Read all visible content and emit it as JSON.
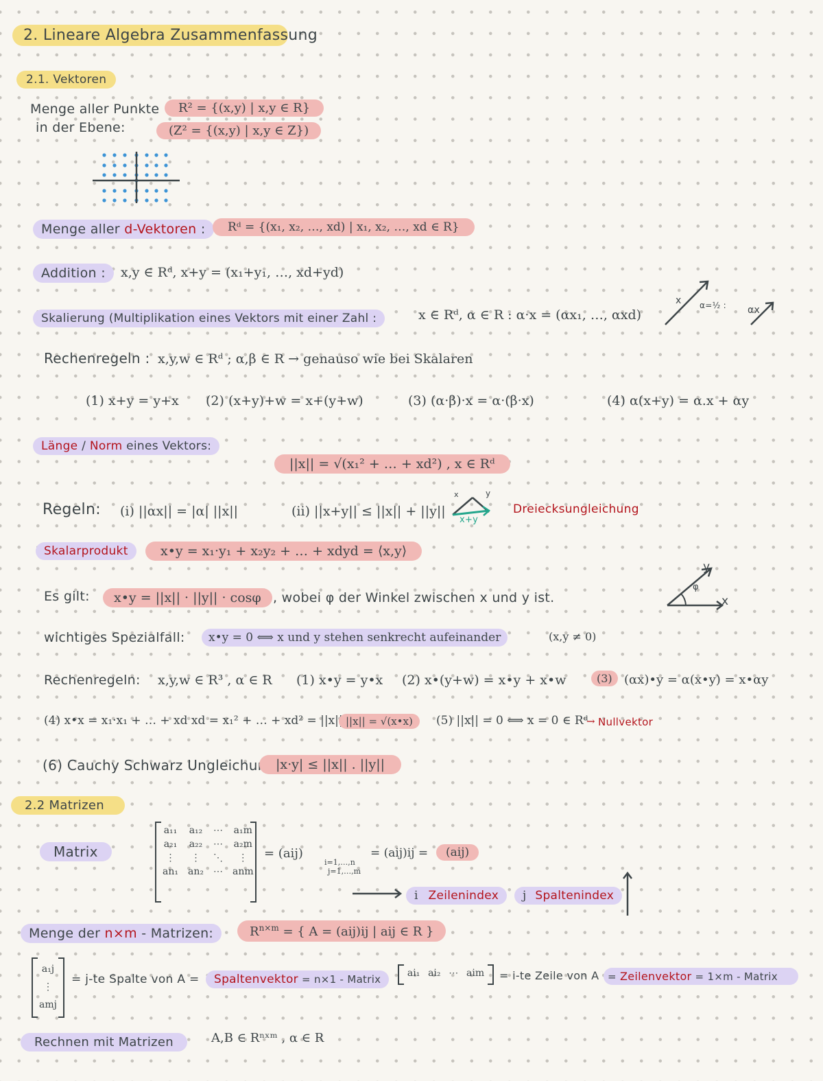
{
  "title": "2. Lineare Algebra Zusammenfassung",
  "section_vectors": {
    "heading": "2.1. Vektoren",
    "points_label_line1": "Menge aller Punkte",
    "points_label_line2": "in der Ebene:",
    "r2_def": "R² = {(x,y) | x,y ∈ R}",
    "z2_def": "(Z² = {(x,y) | x,y ∈ Z})",
    "dvectors_label_prefix": "Menge aller ",
    "dvectors_label_red": "d-Vektoren",
    "dvectors_label_suffix": " :",
    "rd_def": "Rᵈ = {(x₁, x₂, …, xd) | x₁, x₂, …, xd ∈ R}",
    "addition_label": "Addition :",
    "addition_formula": "x,y ∈ Rᵈ,  x+y = (x₁+y₁, …, xd+yd)",
    "scaling_label": "Skalierung (Multiplikation eines Vektors mit einer Zahl :",
    "scaling_formula": "x ∈ Rᵈ, α ∈ R :  α·x = (αx₁, …, αxd)",
    "scaling_sketch": {
      "x_label": "x",
      "alpha_label": "α=½ :",
      "ax_label": "αx"
    },
    "rules_label": "Rechenregeln :",
    "rules_condition": "x,y,w ∈ Rᵈ ; α,β ∈ R  →  genauso wie bei Skalaren",
    "rules": [
      "(1) x+y = y+x",
      "(2) (x+y)+w = x+(y+w)",
      "(3) (α·β)·x = α·(β·x)",
      "(4) α(x+y) = α.x + αy"
    ],
    "norm_label_red1": "Länge",
    "norm_label_sep": " / ",
    "norm_label_red2": "Norm",
    "norm_label_rest": " eines Vektors:",
    "norm_formula": "||x|| = √(x₁² + … + xd²) ,  x ∈ Rᵈ",
    "norm_rules_label": "Regeln:",
    "norm_rule_i": "(i)  ||αx|| = |α| ||x||",
    "norm_rule_ii": "(ii)  ||x+y|| ≤ ||x|| + ||y||",
    "triangle_sketch": {
      "x_label": "x",
      "y_label": "y",
      "sum_label": "x+y"
    },
    "triangle_name": "Dreiecksungleichung",
    "dot_label": "Skalarprodukt",
    "dot_formula": "x•y = x₁·y₁ + x₂y₂ + … + xdyd  =  ⟨x,y⟩",
    "es_gilt_label": "Es gilt:",
    "es_gilt_formula": "x•y = ||x|| · ||y|| · cosφ",
    "es_gilt_rest": ", wobei φ der Winkel zwischen x und y ist.",
    "angle_sketch": {
      "x_label": "x",
      "y_label": "y",
      "phi_label": "φ"
    },
    "special_label": "wichtiges Spezialfall:",
    "special_formula": "x•y = 0   ⟺  x und y stehen senkrecht aufeinander",
    "special_cond": "(x,y ≠ 0)",
    "dot_rules_label": "Rechenregeln:",
    "dot_rules_cond": "x,y,w ∈ R³ , α ∈ R",
    "dot_rule_1": "(1) x•y = y•x",
    "dot_rule_2": "(2) x•(y+w) = x•y + x•w",
    "dot_rule_3_num": "(3)",
    "dot_rule_3": "(αx)•y = α(x•y) = x•αy",
    "dot_rule_4": "(4) x•x = x₁·x₁ + … + xd xd = x₁² + … + xd² = ||x||²  d.h.",
    "dot_rule_4_hl": "||x|| = √(x•x)",
    "dot_rule_5": "(5) ||x|| = 0 ⟺ x = 0 ∈ Rᵈ",
    "dot_rule_5_arrow": "→",
    "dot_rule_5_red": "Nullvektor",
    "cauchy_label": "(6) Cauchy Schwarz Ungleichung",
    "cauchy_formula": "|x·y| ≤ ||x|| . ||y||"
  },
  "section_matrices": {
    "heading": "2.2 Matrizen",
    "matrix_label": "Matrix",
    "matrix_cells": [
      [
        "a₁₁",
        "a₁₂",
        "⋯",
        "a₁m"
      ],
      [
        "a₂₁",
        "a₂₂",
        "⋯",
        "a₂m"
      ],
      [
        "⋮",
        "⋮",
        "⋱",
        "⋮"
      ],
      [
        "an₁",
        "an₂",
        "⋯",
        "anm"
      ]
    ],
    "matrix_eq": "= (aij)",
    "matrix_sub_i": "i=1,…,n",
    "matrix_sub_j": "j=1,…,m",
    "matrix_eq2": "= (aij)ij =",
    "matrix_eq3": "(aij)",
    "row_index_letter": "i",
    "row_index_label": "Zeilenindex",
    "col_index_letter": "j",
    "col_index_label": "Spaltenindex",
    "set_label_prefix": "Menge der ",
    "set_label_red": "n×m",
    "set_label_suffix": " - Matrizen:",
    "set_formula_base": "R",
    "set_formula_sup": "n×m",
    "set_formula_rest": " = { A = (aij)ij | aij ∈ R }",
    "col_vector_cells": [
      "a₁j",
      "⋮",
      "amj"
    ],
    "col_vector_text": "= j-te Spalte von A =",
    "col_vector_red": "Spaltenvektor",
    "col_vector_rest": " = n×1 - Matrix",
    "row_vector_cells": [
      "ai₁",
      "ai₂",
      "⋯",
      "aim"
    ],
    "row_vector_text": "= i-te Zeile von A",
    "row_vector_eq": " = ",
    "row_vector_red": "Zeilenvektor",
    "row_vector_rest": " = 1×m - Matrix",
    "calc_label": "Rechnen mit Matrizen",
    "calc_formula": "A,B ∈ Rⁿˣᵐ , α ∈ R"
  },
  "colors": {
    "ink": "#3d4548",
    "red_ink": "#b3141c",
    "teal_ink": "#23a68c",
    "blue_dots": "#3d94d6",
    "highlight_yellow": "#f5df87",
    "highlight_purple": "#dcd3f3",
    "highlight_red": "#f1b9b6",
    "paper": "#f8f6f1"
  }
}
